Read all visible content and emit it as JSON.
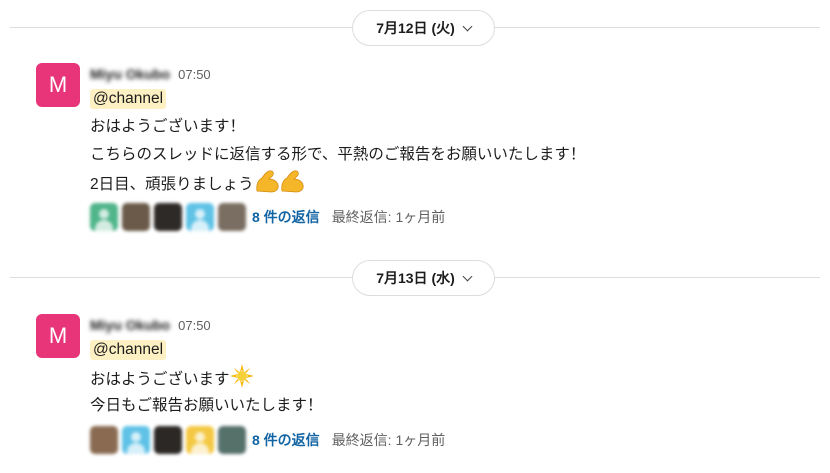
{
  "days": [
    {
      "date_label": "7月12日 (火)",
      "message": {
        "avatar_letter": "M",
        "sender": "Miyu Okubo",
        "time": "07:50",
        "mention": "@channel",
        "lines": [
          "おはようございます！",
          "こちらのスレッドに返信する形で、平熱のご報告をお願いいたします！",
          "2日目、頑張りましょう"
        ],
        "trailing_emoji": "flexed-biceps-x2",
        "thread": {
          "reply_count": "8 件の返信",
          "last_reply": "最終返信: 1ヶ月前"
        }
      }
    },
    {
      "date_label": "7月13日 (水)",
      "message": {
        "avatar_letter": "M",
        "sender": "Miyu Okubo",
        "time": "07:50",
        "mention": "@channel",
        "lines": [
          "おはようございます",
          "今日もご報告お願いいたします！"
        ],
        "trailing_emoji": "sunburst",
        "thread": {
          "reply_count": "8 件の返信",
          "last_reply": "最終返信: 1ヶ月前"
        }
      }
    }
  ],
  "colors": {
    "avatar_bg": "#e8357a",
    "mention_bg": "#fdf0c2",
    "link": "#1264a3",
    "muted": "#616061"
  },
  "icons": [
    "chevron-down-icon",
    "flexed-biceps-icon",
    "sunburst-icon",
    "user-avatar-icon"
  ]
}
